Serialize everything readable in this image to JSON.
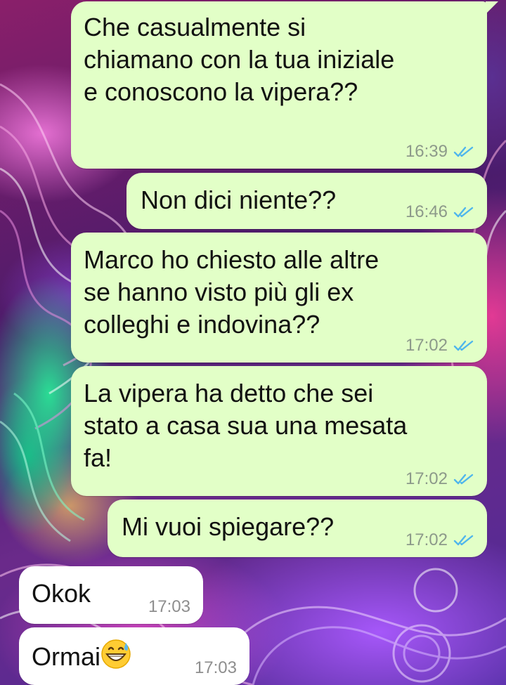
{
  "colors": {
    "outgoing_bubble": "#e2ffc7",
    "incoming_bubble": "#ffffff",
    "read_ticks": "#4fb6ec"
  },
  "messages": [
    {
      "direction": "outgoing",
      "text": "Che casualmente si\nchiamano con la tua iniziale\ne conoscono la vipera??",
      "time": "16:39",
      "status": "read"
    },
    {
      "direction": "outgoing",
      "text": "Non dici niente??",
      "time": "16:46",
      "status": "read"
    },
    {
      "direction": "outgoing",
      "text": "Marco ho chiesto alle altre\nse hanno visto più gli ex\ncolleghi e indovina??",
      "time": "17:02",
      "status": "read"
    },
    {
      "direction": "outgoing",
      "text": "La vipera ha detto che sei\nstato a casa sua una mesata\nfa!",
      "time": "17:02",
      "status": "read"
    },
    {
      "direction": "outgoing",
      "text": "Mi vuoi spiegare??",
      "time": "17:02",
      "status": "read"
    },
    {
      "direction": "incoming",
      "text": "Okok",
      "time": "17:03"
    },
    {
      "direction": "incoming",
      "text": "Ormai",
      "emoji": "grinning-face-with-sweat",
      "time": "17:03"
    }
  ]
}
